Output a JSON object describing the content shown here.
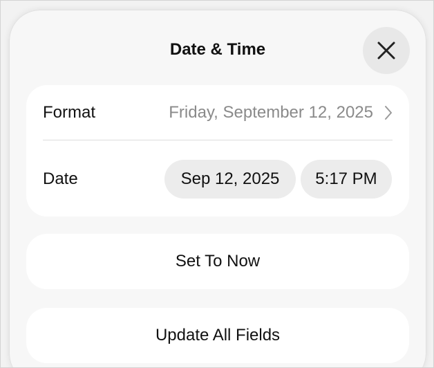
{
  "sheet": {
    "title": "Date & Time",
    "close_icon": "close-icon"
  },
  "settings": {
    "format": {
      "label": "Format",
      "value": "Friday, September 12, 2025",
      "chevron_icon": "chevron-right-icon"
    },
    "date": {
      "label": "Date",
      "date_value": "Sep 12, 2025",
      "time_value": "5:17 PM"
    }
  },
  "actions": {
    "set_to_now": "Set To Now",
    "update_all_fields": "Update All Fields"
  },
  "colors": {
    "background": "#f2f2f2",
    "sheet": "#f7f7f7",
    "card": "#ffffff",
    "pill": "#ececec",
    "secondary_text": "#8a8a8a"
  }
}
